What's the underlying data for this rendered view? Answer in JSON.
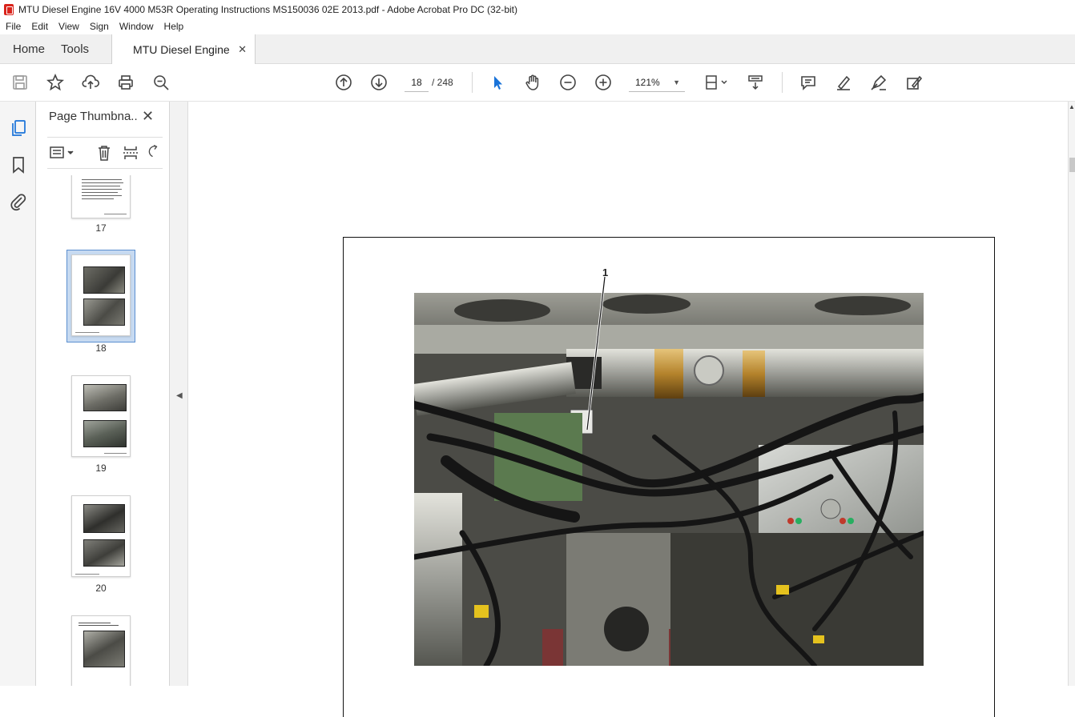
{
  "window": {
    "title": "MTU Diesel Engine 16V 4000 M53R Operating Instructions MS150036 02E 2013.pdf - Adobe Acrobat Pro DC (32-bit)"
  },
  "menu": [
    "File",
    "Edit",
    "View",
    "Sign",
    "Window",
    "Help"
  ],
  "tabs": {
    "home": "Home",
    "tools": "Tools",
    "document": "MTU Diesel Engine ..."
  },
  "toolbar": {
    "left_icons": [
      "save-icon",
      "bookmark-star-icon",
      "upload-icon",
      "print-icon",
      "zoom-search-icon"
    ],
    "current_page": "18",
    "page_total": "/ 248",
    "zoom": "121%",
    "right_icons": [
      "comment-icon",
      "highlight-icon",
      "draw-icon",
      "fill-sign-icon"
    ]
  },
  "thumbnail_panel": {
    "title": "Page Thumbna...",
    "pages": [
      {
        "number": "17"
      },
      {
        "number": "18",
        "selected": true
      },
      {
        "number": "19"
      },
      {
        "number": "20"
      }
    ]
  },
  "document": {
    "callout": "1"
  }
}
